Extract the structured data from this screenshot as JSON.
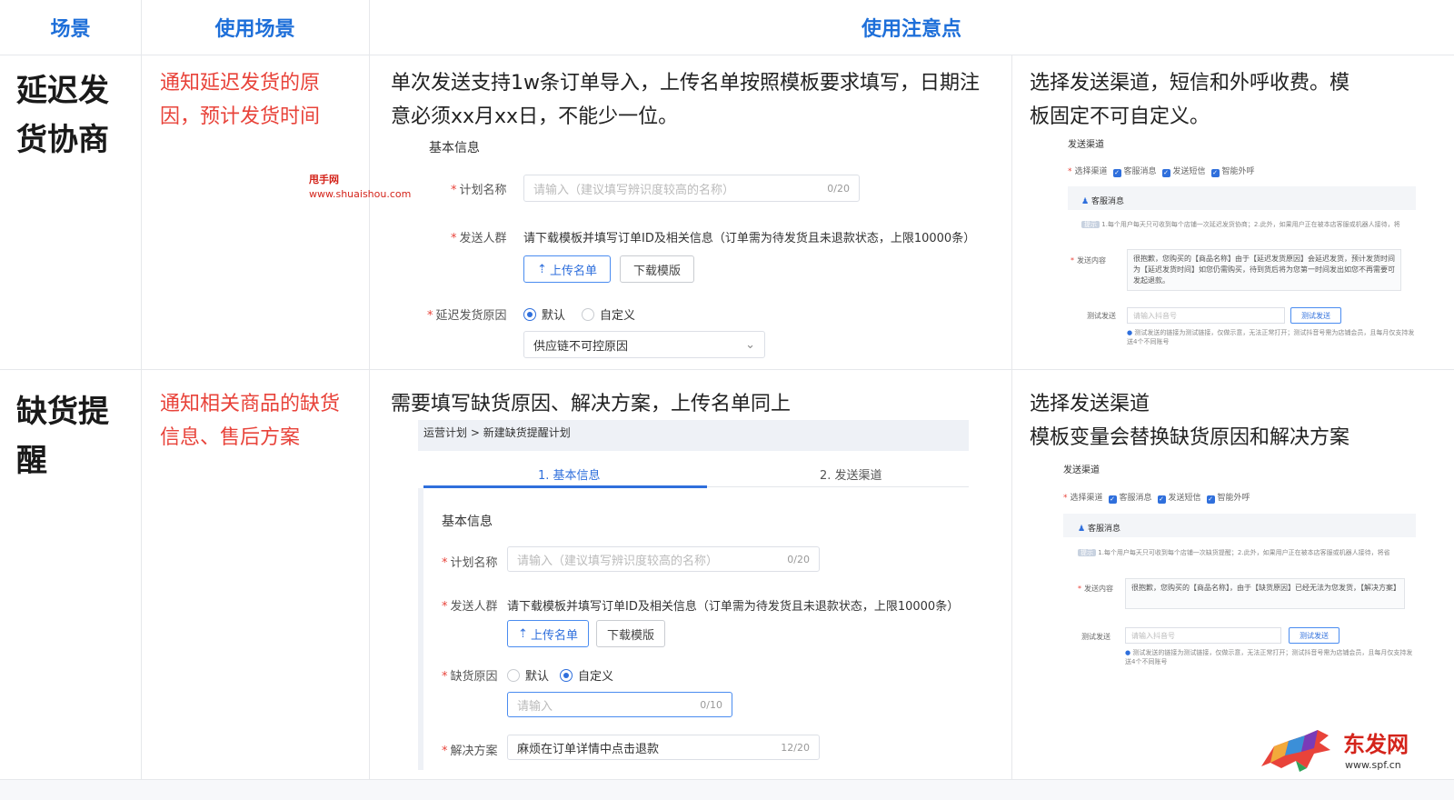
{
  "header": {
    "col1": "场景",
    "col2": "使用场景",
    "col3": "使用注意点"
  },
  "rows": [
    {
      "scene": "延迟发货协商",
      "purpose": "通知延迟发货的原因，预计发货时间",
      "note_left": "单次发送支持1w条订单导入，上传名单按照模板要求填写，日期注意必须xx月xx日，不能少一位。",
      "note_right": "选择发送渠道，短信和外呼收费。模板固定不可自定义。"
    },
    {
      "scene": "缺货提醒",
      "purpose": "通知相关商品的缺货信息、售后方案",
      "note_left": "需要填写缺货原因、解决方案，上传名单同上",
      "note_right_1": "选择发送渠道",
      "note_right_2": "模板变量会替换缺货原因和解决方案"
    }
  ],
  "watermark": {
    "title": "甩手网",
    "url": "www.shuaishou.com"
  },
  "form1": {
    "section": "基本信息",
    "plan_label": "计划名称",
    "plan_placeholder": "请输入（建议填写辨识度较高的名称）",
    "plan_count": "0/20",
    "crowd_label": "发送人群",
    "crowd_text": "请下载模板并填写订单ID及相关信息（订单需为待发货且未退款状态，上限10000条）",
    "upload": "上传名单",
    "download": "下载模版",
    "reason_label": "延迟发货原因",
    "radio_default": "默认",
    "radio_custom": "自定义",
    "reason_select": "供应链不可控原因"
  },
  "form2": {
    "breadcrumb_1": "运营计划",
    "breadcrumb_sep": ">",
    "breadcrumb_2": "新建缺货提醒计划",
    "step1": "1. 基本信息",
    "step2": "2. 发送渠道",
    "section": "基本信息",
    "plan_label": "计划名称",
    "plan_placeholder": "请输入（建议填写辨识度较高的名称）",
    "plan_count": "0/20",
    "crowd_label": "发送人群",
    "crowd_text": "请下载模板并填写订单ID及相关信息（订单需为待发货且未退款状态，上限10000条）",
    "upload": "上传名单",
    "download": "下载模版",
    "reason_label": "缺货原因",
    "radio_default": "默认",
    "radio_custom": "自定义",
    "reason_placeholder": "请输入",
    "reason_count": "0/10",
    "solution_label": "解决方案",
    "solution_value": "麻烦在订单详情中点击退款",
    "solution_count": "12/20"
  },
  "channel1": {
    "title": "发送渠道",
    "select_label": "选择渠道",
    "opt1": "客服消息",
    "opt2": "发送短信",
    "opt3": "智能外呼",
    "panel_title": "客服消息",
    "tip_badge": "提示",
    "tip_text": "1.每个用户每天只可收到每个店铺一次延迟发货协商；2.此外，如果用户正在被本店客服或机器人接待，将",
    "content_label": "发送内容",
    "content_text": "很抱歉，您购买的【商品名称】由于【延迟发货原因】会延迟发货，预计发货时间为【延迟发货时间】如您仍需购买，待到货后将为您第一时间发出如您不再需要可发起退款。",
    "test_label": "测试发送",
    "test_placeholder": "请输入抖音号",
    "test_button": "测试发送",
    "note": "测试发送的链接为测试链接，仅做示意，无法正常打开；测试抖音号需为店铺会员，且每月仅支持发送4个不同账号"
  },
  "channel2": {
    "title": "发送渠道",
    "select_label": "选择渠道",
    "opt1": "客服消息",
    "opt2": "发送短信",
    "opt3": "智能外呼",
    "panel_title": "客服消息",
    "tip_badge": "提示",
    "tip_text": "1.每个用户每天只可收到每个店铺一次缺货提醒；2.此外，如果用户正在被本店客服或机器人接待，将省",
    "content_label": "发送内容",
    "content_text": "很抱歉，您购买的【商品名称】，由于【缺货原因】已经无法为您发货，【解决方案】",
    "test_label": "测试发送",
    "test_placeholder": "请输入抖音号",
    "test_button": "测试发送",
    "note": "测试发送的链接为测试链接，仅做示意，无法正常打开；测试抖音号需为店铺会员，且每月仅支持发送4个不同账号"
  },
  "logo": {
    "text": "东发网",
    "url": "www.spf.cn"
  }
}
